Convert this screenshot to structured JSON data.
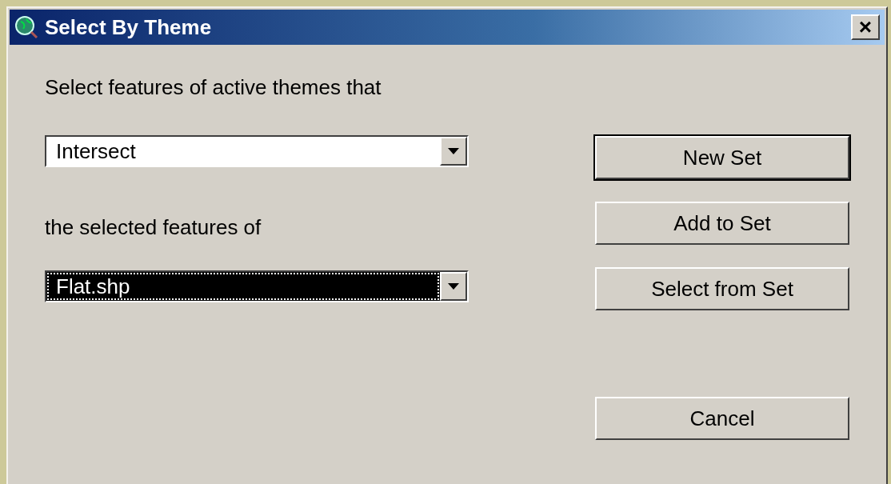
{
  "window": {
    "title": "Select By Theme",
    "close": "×"
  },
  "prompt": "Select features of active themes that",
  "relation": {
    "value": "Intersect",
    "focused": false
  },
  "target_label": "the selected features of",
  "target": {
    "value": "Flat.shp",
    "focused": true
  },
  "buttons": [
    {
      "label": "New Set",
      "default": true
    },
    {
      "label": "Add to Set",
      "default": false
    },
    {
      "label": "Select from Set",
      "default": false
    }
  ],
  "cancel": {
    "label": "Cancel",
    "default": false
  }
}
